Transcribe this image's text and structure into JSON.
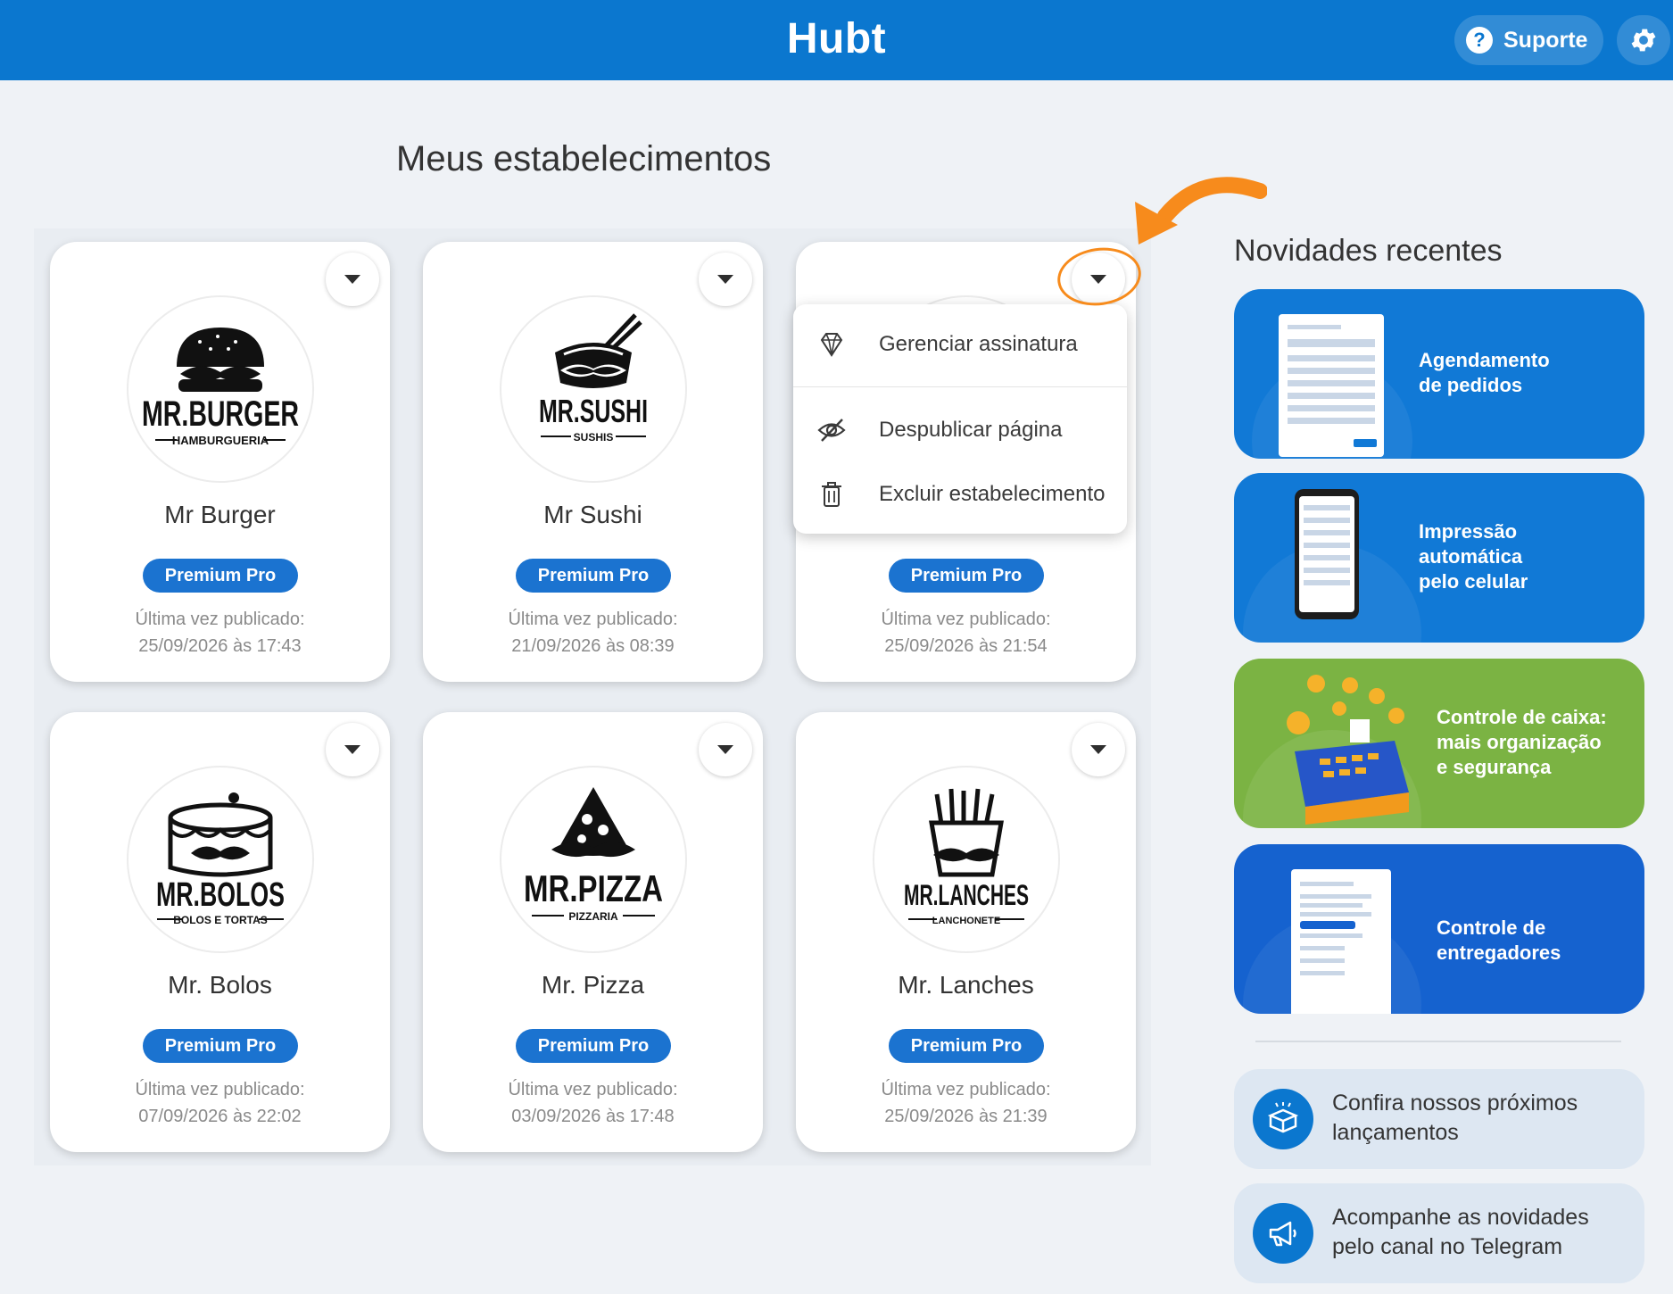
{
  "header": {
    "brand": "Hubt",
    "support_label": "Suporte"
  },
  "page": {
    "title": "Meus estabelecimentos"
  },
  "establishments": [
    {
      "name": "Mr Burger",
      "logo_title": "MR.BURGER",
      "logo_subtitle": "HAMBURGUERIA",
      "badge": "Premium Pro",
      "published_label": "Última vez publicado:",
      "published_at": "25/09/2026 às 17:43"
    },
    {
      "name": "Mr Sushi",
      "logo_title": "MR.SUSHI",
      "logo_subtitle": "SUSHIS",
      "badge": "Premium Pro",
      "published_label": "Última vez publicado:",
      "published_at": "21/09/2026 às 08:39"
    },
    {
      "name": "",
      "badge": "Premium Pro",
      "published_label": "Última vez publicado:",
      "published_at": "25/09/2026 às 21:54"
    },
    {
      "name": "Mr. Bolos",
      "logo_title": "MR.BOLOS",
      "logo_subtitle": "BOLOS E TORTAS",
      "badge": "Premium Pro",
      "published_label": "Última vez publicado:",
      "published_at": "07/09/2026 às 22:02"
    },
    {
      "name": "Mr. Pizza",
      "logo_title": "MR.PIZZA",
      "logo_subtitle": "PIZZARIA",
      "badge": "Premium Pro",
      "published_label": "Última vez publicado:",
      "published_at": "03/09/2026 às 17:48"
    },
    {
      "name": "Mr. Lanches",
      "logo_title": "MR.LANCHES",
      "logo_subtitle": "LANCHONETE",
      "badge": "Premium Pro",
      "published_label": "Última vez publicado:",
      "published_at": "25/09/2026 às 21:39"
    }
  ],
  "dropdown": {
    "items": [
      {
        "label": "Gerenciar assinatura",
        "icon": "diamond-icon"
      },
      {
        "label": "Despublicar página",
        "icon": "eye-off-icon"
      },
      {
        "label": "Excluir estabelecimento",
        "icon": "trash-icon"
      }
    ]
  },
  "news": {
    "title": "Novidades recentes",
    "cards": [
      {
        "line1": "Agendamento",
        "line2": "de pedidos",
        "color": "#1179d6"
      },
      {
        "line1": "Impressão",
        "line2": "automática",
        "line3": "pelo celular",
        "color": "#1179d6"
      },
      {
        "line1": "Controle de caixa:",
        "line2": "mais organização",
        "line3": "e segurança",
        "color": "#7bb343"
      },
      {
        "line1": "Controle de",
        "line2": "entregadores",
        "color": "#1562cf"
      }
    ],
    "links": [
      {
        "line1": "Confira nossos próximos",
        "line2": "lançamentos",
        "icon": "box-icon"
      },
      {
        "line1": "Acompanhe as novidades",
        "line2": "pelo canal no Telegram",
        "icon": "megaphone-icon"
      }
    ]
  },
  "colors": {
    "primary": "#0b77cf",
    "badge": "#1b73d0",
    "accent_orange": "#f78b1c",
    "green": "#7bb343"
  }
}
